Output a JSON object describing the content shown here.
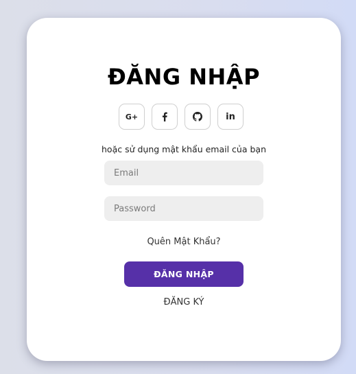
{
  "login_card": {
    "title": "ĐĂNG NHẬP",
    "social_buttons": [
      {
        "icon": "google-plus-icon",
        "glyph": "G+"
      },
      {
        "icon": "facebook-icon"
      },
      {
        "icon": "github-icon"
      },
      {
        "icon": "linkedin-icon",
        "glyph": "in"
      }
    ],
    "alt_text": "hoặc sử dụng mật khẩu email của bạn",
    "email_placeholder": "Email",
    "password_placeholder": "Password",
    "forgot_password": "Quên Mật Khẩu?",
    "login_button": "ĐĂNG NHẬP",
    "register_link": "ĐĂNG KÝ"
  },
  "colors": {
    "accent": "#5630a8",
    "input_bg": "#eeeeee",
    "card_bg": "#ffffff"
  }
}
